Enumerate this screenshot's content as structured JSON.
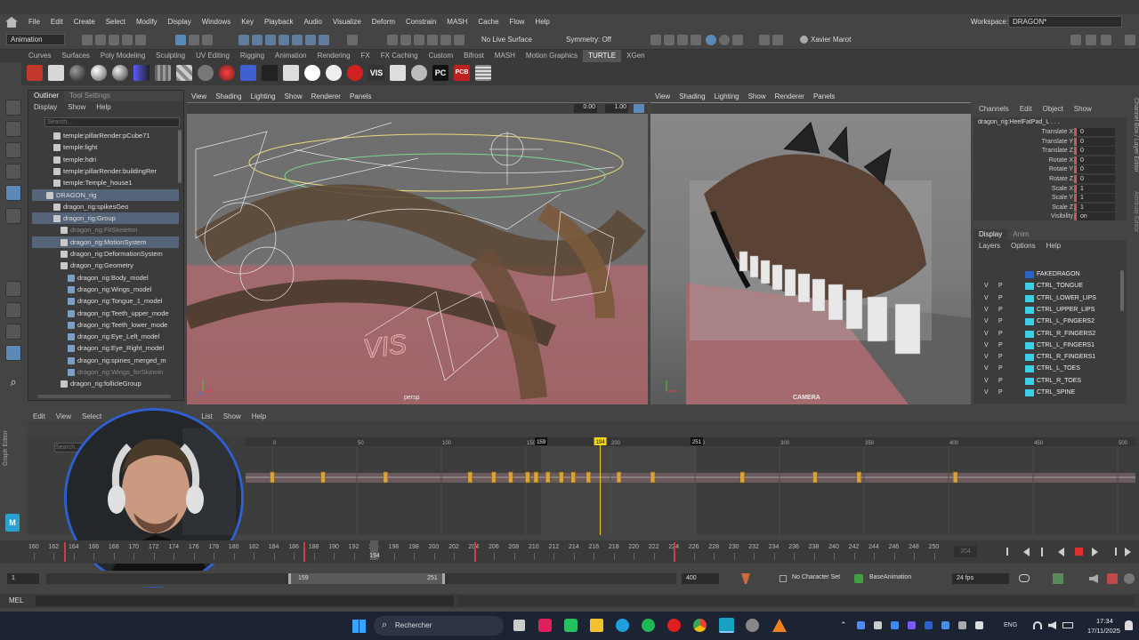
{
  "menubar": {
    "items": [
      "File",
      "Edit",
      "Create",
      "Select",
      "Modify",
      "Display",
      "Windows",
      "Key",
      "Playback",
      "Audio",
      "Visualize",
      "Deform",
      "Constrain",
      "MASH",
      "Cache",
      "Flow",
      "Help"
    ],
    "workspace_label": "Workspace:",
    "workspace_value": "DRAGON*"
  },
  "statusline": {
    "mode": "Animation",
    "live_surface": "No Live Surface",
    "symmetry": "Symmetry: Off",
    "user": "Xavier Marot"
  },
  "shelf": {
    "tabs": [
      "Curves",
      "Surfaces",
      "Poly Modeling",
      "Sculpting",
      "UV Editing",
      "Rigging",
      "Animation",
      "Rendering",
      "FX",
      "FX Caching",
      "Custom",
      "Bifrost",
      "MASH",
      "Motion Graphics",
      "TURTLE",
      "XGen"
    ],
    "active_tab": "TURTLE",
    "icon_labels": [
      "VIS",
      "PC",
      "PCB"
    ]
  },
  "outliner": {
    "tabs": [
      "Outliner",
      "Tool Settings"
    ],
    "menu": [
      "Display",
      "Show",
      "Help"
    ],
    "search_placeholder": "Search...",
    "items": [
      {
        "label": "temple:pillarRender:pCube71",
        "indent": 2,
        "state": "normal"
      },
      {
        "label": "temple:light",
        "indent": 2,
        "state": "normal"
      },
      {
        "label": "temple:hdri",
        "indent": 2,
        "state": "normal"
      },
      {
        "label": "temple:pillarRender:buildingRer",
        "indent": 2,
        "state": "normal"
      },
      {
        "label": "temple:Temple_house1",
        "indent": 2,
        "state": "normal"
      },
      {
        "label": "DRAGON_rig",
        "indent": 1,
        "state": "hl"
      },
      {
        "label": "dragon_rig:spikesGeo",
        "indent": 2,
        "state": "normal"
      },
      {
        "label": "dragon_rig:Group",
        "indent": 2,
        "state": "hl"
      },
      {
        "label": "dragon_rig:FitSkeleton",
        "indent": 3,
        "state": "dim"
      },
      {
        "label": "dragon_rig:MotionSystem",
        "indent": 3,
        "state": "hl"
      },
      {
        "label": "dragon_rig:DeformationSystem",
        "indent": 3,
        "state": "normal"
      },
      {
        "label": "dragon_rig:Geometry",
        "indent": 3,
        "state": "normal"
      },
      {
        "label": "dragon_rig:Body_model",
        "indent": 4,
        "state": "normal"
      },
      {
        "label": "dragon_rig:Wings_model",
        "indent": 4,
        "state": "normal"
      },
      {
        "label": "dragon_rig:Tongue_1_model",
        "indent": 4,
        "state": "normal"
      },
      {
        "label": "dragon_rig:Teeth_upper_mode",
        "indent": 4,
        "state": "normal"
      },
      {
        "label": "dragon_rig:Teeth_lower_mode",
        "indent": 4,
        "state": "normal"
      },
      {
        "label": "dragon_rig:Eye_Left_model",
        "indent": 4,
        "state": "normal"
      },
      {
        "label": "dragon_rig:Eye_Right_model",
        "indent": 4,
        "state": "normal"
      },
      {
        "label": "dragon_rig:spines_merged_m",
        "indent": 4,
        "state": "normal"
      },
      {
        "label": "dragon_rig:Wings_forSkinnin",
        "indent": 4,
        "state": "dim"
      },
      {
        "label": "dragon_rig:follicleGroup",
        "indent": 3,
        "state": "normal"
      }
    ]
  },
  "viewport_left": {
    "menu": [
      "View",
      "Shading",
      "Lighting",
      "Show",
      "Renderer",
      "Panels"
    ],
    "camera_label": "persp",
    "field1": "0.00",
    "field2": "1.00",
    "overlay_text": "VIS"
  },
  "viewport_right": {
    "menu": [
      "View",
      "Shading",
      "Lighting",
      "Show",
      "Renderer",
      "Panels"
    ],
    "camera_label": "CAMERA"
  },
  "channel_box": {
    "menu": [
      "Channels",
      "Edit",
      "Object",
      "Show"
    ],
    "node": "dragon_rig:HeelFatPad_L . . .",
    "channels": [
      {
        "name": "Translate X",
        "value": "0"
      },
      {
        "name": "Translate Y",
        "value": "0"
      },
      {
        "name": "Translate Z",
        "value": "0"
      },
      {
        "name": "Rotate X",
        "value": "0"
      },
      {
        "name": "Rotate Y",
        "value": "0"
      },
      {
        "name": "Rotate Z",
        "value": "0"
      },
      {
        "name": "Scale X",
        "value": "1"
      },
      {
        "name": "Scale Y",
        "value": "1"
      },
      {
        "name": "Scale Z",
        "value": "1"
      },
      {
        "name": "Visibility",
        "value": "on"
      }
    ],
    "side_tabs": [
      "Channel Box / Layer Editor",
      "Attribute Editor"
    ]
  },
  "layer_editor": {
    "tabs": [
      "Display",
      "Anim"
    ],
    "menu": [
      "Layers",
      "Options",
      "Help"
    ],
    "layers": [
      {
        "name": "FAKEDRAGON",
        "v": "",
        "p": "",
        "color": "#2a64c8"
      },
      {
        "name": "CTRL_TONGUE",
        "v": "V",
        "p": "P",
        "color": "#3ad0e8"
      },
      {
        "name": "CTRL_LOWER_LIPS",
        "v": "V",
        "p": "P",
        "color": "#3ad0e8"
      },
      {
        "name": "CTRL_UPPER_LIPS",
        "v": "V",
        "p": "P",
        "color": "#3ad0e8"
      },
      {
        "name": "CTRL_L_FINGERS2",
        "v": "V",
        "p": "P",
        "color": "#3ad0e8"
      },
      {
        "name": "CTRL_R_FINGERS2",
        "v": "V",
        "p": "P",
        "color": "#3ad0e8"
      },
      {
        "name": "CTRL_L_FINGERS1",
        "v": "V",
        "p": "P",
        "color": "#3ad0e8"
      },
      {
        "name": "CTRL_R_FINGERS1",
        "v": "V",
        "p": "P",
        "color": "#3ad0e8"
      },
      {
        "name": "CTRL_L_TOES",
        "v": "V",
        "p": "P",
        "color": "#3ad0e8"
      },
      {
        "name": "CTRL_R_TOES",
        "v": "V",
        "p": "P",
        "color": "#3ad0e8"
      },
      {
        "name": "CTRL_SPINE",
        "v": "V",
        "p": "P",
        "color": "#3ad0e8"
      }
    ]
  },
  "graph_editor": {
    "side_label": "Graph Editor",
    "menu": [
      "Edit",
      "View",
      "Select",
      "List",
      "Show",
      "Help"
    ],
    "search_placeholder": "Search...",
    "ruler_ticks": [
      "0",
      "50",
      "100",
      "150",
      "200",
      "250",
      "300",
      "350",
      "400",
      "450",
      "500"
    ],
    "marker_start": "159",
    "marker_current": "194",
    "marker_end": "251",
    "key_frames": [
      0,
      30,
      67,
      117,
      131,
      141,
      151,
      156,
      163,
      171,
      178,
      187,
      205,
      225,
      278,
      321,
      347,
      404
    ]
  },
  "time_slider": {
    "ticks": [
      "160",
      "162",
      "164",
      "166",
      "168",
      "170",
      "172",
      "174",
      "176",
      "178",
      "180",
      "182",
      "184",
      "186",
      "188",
      "190",
      "192",
      "194",
      "196",
      "198",
      "200",
      "202",
      "204",
      "206",
      "208",
      "210",
      "212",
      "214",
      "216",
      "218",
      "220",
      "222",
      "224",
      "226",
      "228",
      "230",
      "232",
      "234",
      "236",
      "238",
      "240",
      "242",
      "244",
      "246",
      "248",
      "250"
    ],
    "current_frame": "194",
    "end_field": "204",
    "key_frames": [
      163,
      187,
      204,
      224
    ]
  },
  "range_slider": {
    "start": "1",
    "range_start": "159",
    "range_end": "251",
    "end": "400",
    "character_set": "No Character Set",
    "anim_layer": "BaseAnimation",
    "fps": "24 fps"
  },
  "command_line": {
    "label": "MEL"
  },
  "taskbar": {
    "search_placeholder": "Rechercher",
    "lang": "ENG",
    "time": "17:34",
    "date": "17/11/2025"
  },
  "colors": {
    "accent": "#5a8ab5",
    "keyframe": "#d9a23b",
    "current_time": "#f2d31b",
    "webcam_ring": "#2f5fd0",
    "layer_swatch": "#3ad0e8",
    "range_marker": "#d83b3b"
  }
}
